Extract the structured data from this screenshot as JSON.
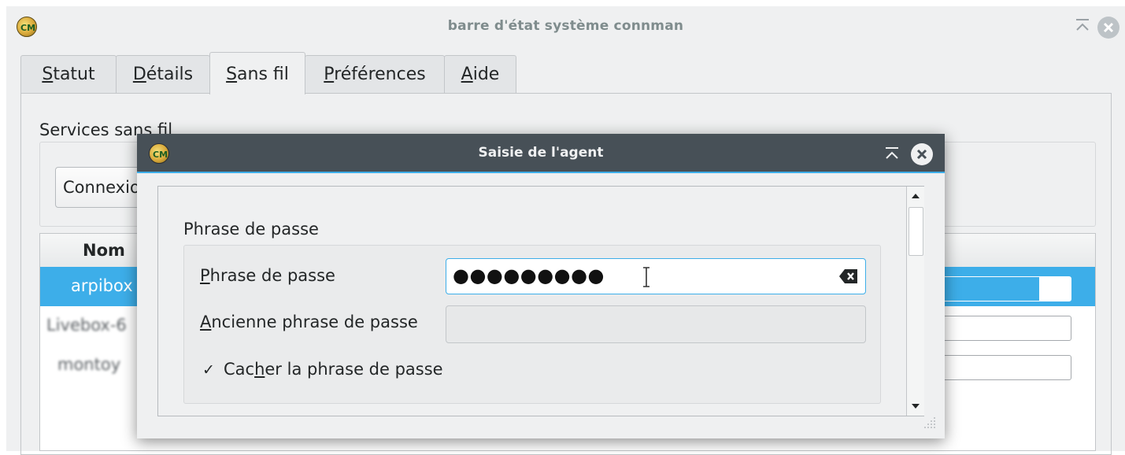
{
  "main_window": {
    "title": "barre d'état système connman",
    "tabs": [
      {
        "pre": "",
        "key": "S",
        "post": "tatut"
      },
      {
        "pre": "",
        "key": "D",
        "post": "étails"
      },
      {
        "pre": "",
        "key": "S",
        "post": "ans fil"
      },
      {
        "pre": "",
        "key": "P",
        "post": "références"
      },
      {
        "pre": "",
        "key": "A",
        "post": "ide"
      }
    ],
    "active_tab": "Sans fil",
    "section_label": "Services sans fil",
    "connect_button": "Connexion",
    "table": {
      "column_name": "Nom",
      "rows": [
        {
          "name": "arpibox",
          "signal": 0.8
        },
        {
          "name": "Livebox-6",
          "signal": 0
        },
        {
          "name": "montoy",
          "signal": 0
        }
      ]
    }
  },
  "dialog": {
    "title": "Saisie de l'agent",
    "group_label": "Phrase de passe",
    "passphrase_label": {
      "pre": "",
      "key": "P",
      "post": "hrase de passe"
    },
    "passphrase_value": "●●●●●●●●●",
    "old_passphrase_label": {
      "pre": "",
      "key": "A",
      "post": "ncienne phrase de passe"
    },
    "old_passphrase_value": "",
    "hide_checkbox": {
      "checked": true,
      "mark": "✓",
      "pre": "Cac",
      "key": "h",
      "post": "er la phrase de passe"
    }
  },
  "colors": {
    "accent": "#3daee9",
    "titlebar_dark": "#475057",
    "window_bg": "#eff0f1"
  },
  "icons": [
    "connman-logo-icon",
    "keep-above-icon",
    "close-icon",
    "clear-text-icon",
    "text-cursor-icon",
    "scroll-up-icon",
    "scroll-down-icon",
    "resize-grip-icon"
  ]
}
